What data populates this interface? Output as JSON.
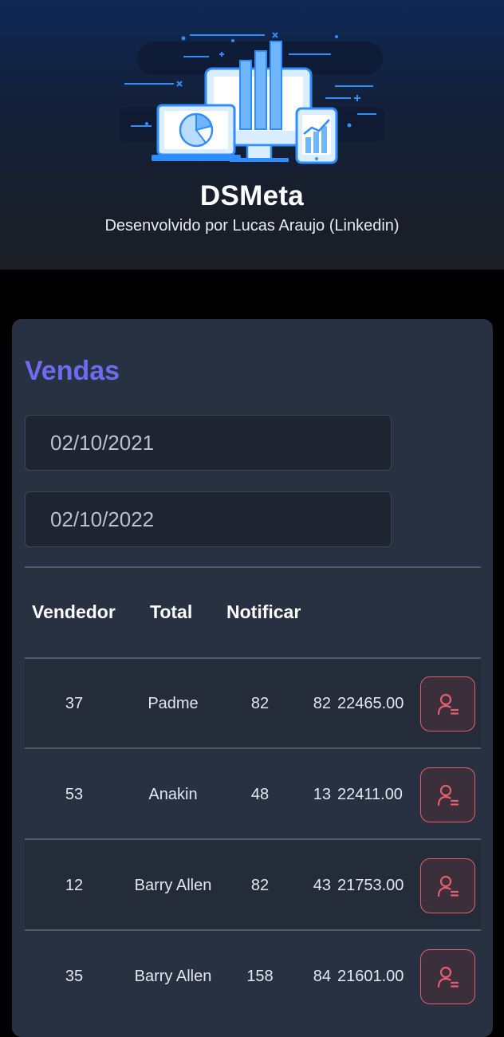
{
  "header": {
    "title": "DSMeta",
    "subtitle": "Desenvolvido por Lucas Araujo (Linkedin)"
  },
  "sales": {
    "title": "Vendas",
    "min_date": "02/10/2021",
    "max_date": "02/10/2022",
    "columns": [
      "Vendedor",
      "Total",
      "Notificar"
    ],
    "rows": [
      {
        "id": "37",
        "seller": "Padme",
        "visited": "82",
        "deals": "82",
        "amount": "22465.00"
      },
      {
        "id": "53",
        "seller": "Anakin",
        "visited": "48",
        "deals": "13",
        "amount": "22411.00"
      },
      {
        "id": "12",
        "seller": "Barry Allen",
        "visited": "82",
        "deals": "43",
        "amount": "21753.00"
      },
      {
        "id": "35",
        "seller": "Barry Allen",
        "visited": "158",
        "deals": "84",
        "amount": "21601.00"
      }
    ]
  },
  "colors": {
    "accent": "#6b6cf0",
    "notify": "#e45e6c",
    "card": "#283142"
  },
  "icons": {
    "notify": "user-notify-icon",
    "hero": "dashboard-devices-illustration"
  }
}
